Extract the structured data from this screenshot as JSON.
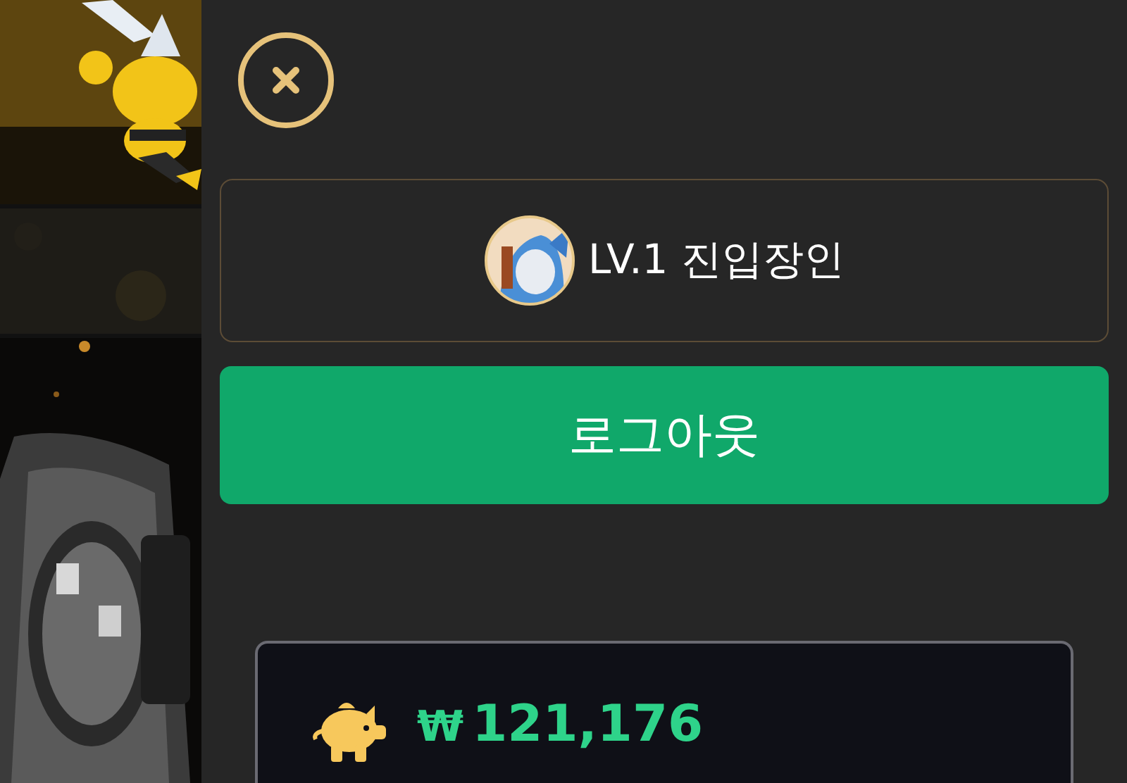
{
  "profile": {
    "level": "LV.1 진입장인"
  },
  "logout_button": {
    "label": "로그아웃"
  },
  "balance": {
    "currency": "₩",
    "amount": "121,176"
  }
}
